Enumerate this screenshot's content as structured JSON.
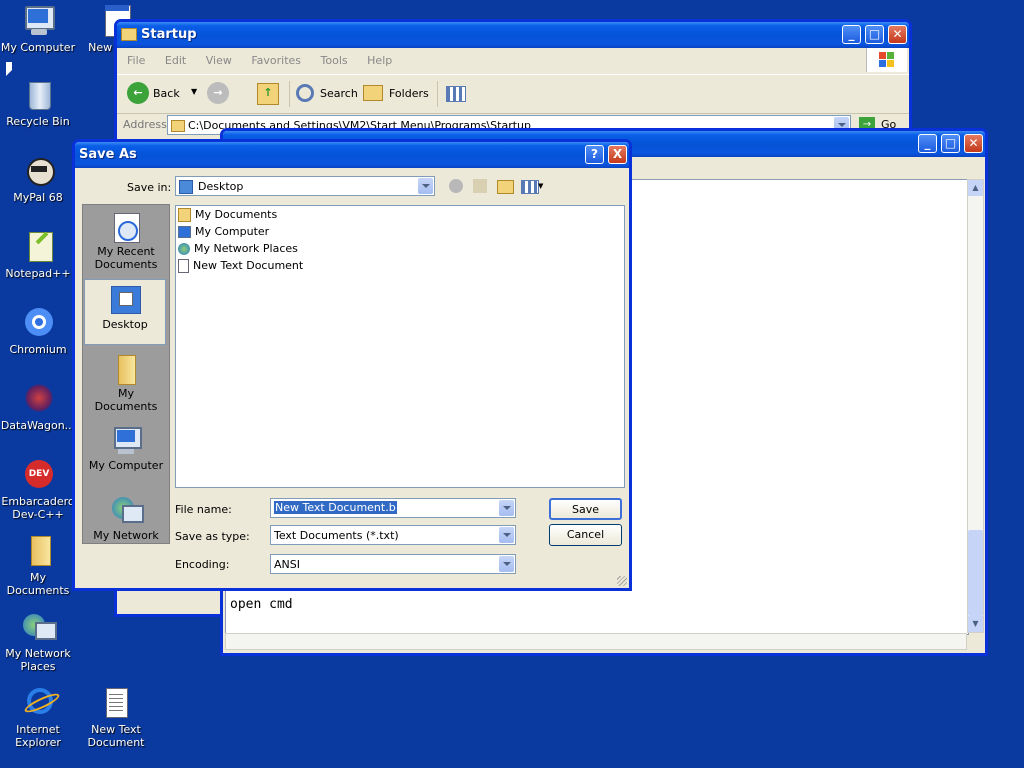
{
  "desktop": {
    "icons": [
      {
        "label": "My Computer"
      },
      {
        "label": "New Docu"
      },
      {
        "label": "Recycle Bin"
      },
      {
        "label": "MyPal 68"
      },
      {
        "label": "Notepad++"
      },
      {
        "label": "Chromium"
      },
      {
        "label": "DataWagon..."
      },
      {
        "label": "Embarcadero Dev-C++"
      },
      {
        "label": "My Documents"
      },
      {
        "label": "My Network Places"
      },
      {
        "label": "Internet Explorer"
      },
      {
        "label": "New Text Document"
      }
    ]
  },
  "explorer": {
    "title": "Startup",
    "menu": [
      "File",
      "Edit",
      "View",
      "Favorites",
      "Tools",
      "Help"
    ],
    "toolbar": {
      "back": "Back",
      "search": "Search",
      "folders": "Folders"
    },
    "address_label": "Address",
    "address_value": "C:\\Documents and Settings\\VM2\\Start Menu\\Programs\\Startup",
    "go": "Go"
  },
  "notepad": {
    "text": "open cmd"
  },
  "dialog": {
    "title": "Save As",
    "save_in_label": "Save in:",
    "save_in_value": "Desktop",
    "places": [
      "My Recent Documents",
      "Desktop",
      "My Documents",
      "My Computer",
      "My Network"
    ],
    "files": [
      "My Documents",
      "My Computer",
      "My Network Places",
      "New Text Document"
    ],
    "file_name_label": "File name:",
    "file_name_value": "New Text Document.b",
    "save_as_type_label": "Save as type:",
    "save_as_type_value": "Text Documents (*.txt)",
    "encoding_label": "Encoding:",
    "encoding_value": "ANSI",
    "save_button": "Save",
    "cancel_button": "Cancel",
    "help_button": "?",
    "close_button": "X"
  },
  "colors": {
    "desktop": "#0a3aa0",
    "titlebar": "#0553d7",
    "selection": "#316ac5"
  }
}
